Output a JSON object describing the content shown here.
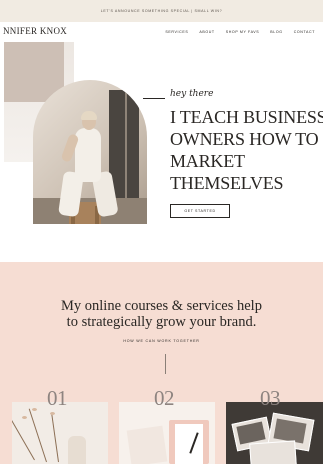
{
  "announcement": "LET'S ANNOUNCE SOMETHING SPECIAL | SMALL WIN?",
  "brand": "NNIFER KNOX",
  "nav": {
    "items": [
      "SERVICES",
      "ABOUT",
      "SHOP MY FAVS",
      "BLOG",
      "CONTACT"
    ]
  },
  "hero": {
    "script_text": "hey there",
    "headline": [
      "I TEACH BUSINESS",
      "OWNERS HOW TO",
      "MARKET",
      "THEMSELVES"
    ],
    "cta_label": "GET STARTED"
  },
  "intro": {
    "tagline": [
      "My online courses & services help",
      "to strategically grow your brand."
    ],
    "subheading": "HOW WE CAN WORK TOGETHER"
  },
  "offerings": [
    {
      "number": "01"
    },
    {
      "number": "02"
    },
    {
      "number": "03"
    }
  ],
  "colors": {
    "announcement_bg": "#f1ebe2",
    "pink_section": "#f6ddd3",
    "text": "#2a2724"
  }
}
